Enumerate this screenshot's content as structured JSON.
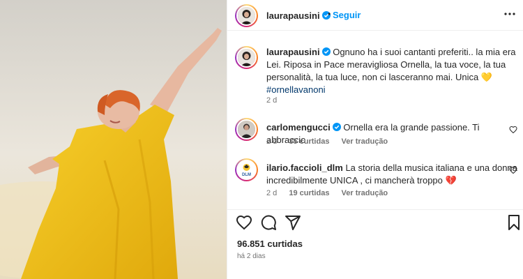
{
  "post": {
    "image_alt": "Mulher de vestido amarelo com os braços abertos"
  },
  "header": {
    "username": "laurapausini",
    "separator": "•",
    "follow_label": "Seguir"
  },
  "caption": {
    "username": "laurapausini",
    "text": "Ognuno ha i suoi cantanti preferiti.. la mia era Lei. Riposa in Pace meravigliosa Ornella, la tua voce, la tua personalità, la tua luce, non ci lasceranno mai. Unica 💛",
    "hashtag": "#ornellavanoni",
    "time": "2 d"
  },
  "comments": [
    {
      "username": "carlomengucci",
      "text": "Ornella era la grande passione. Ti abbraccio",
      "time": "2 d",
      "likes": "35 curtidas",
      "reply": "Ver tradução"
    },
    {
      "username": "ilario.faccioli_dlm",
      "text": "La storia della musica italiana e una donna incredibilmente UNICA , ci mancherà troppo 💔",
      "time": "2 d",
      "likes": "19 curtidas",
      "reply": "Ver tradução"
    }
  ],
  "footer": {
    "likes": "96.851 curtidas",
    "ago": "há 2 dias"
  },
  "avatar_logo_text": "DLM",
  "colors": {
    "link": "#0095f6",
    "hashtag": "#00376b",
    "verified": "#0095f6",
    "dress": "#f2c31a"
  }
}
